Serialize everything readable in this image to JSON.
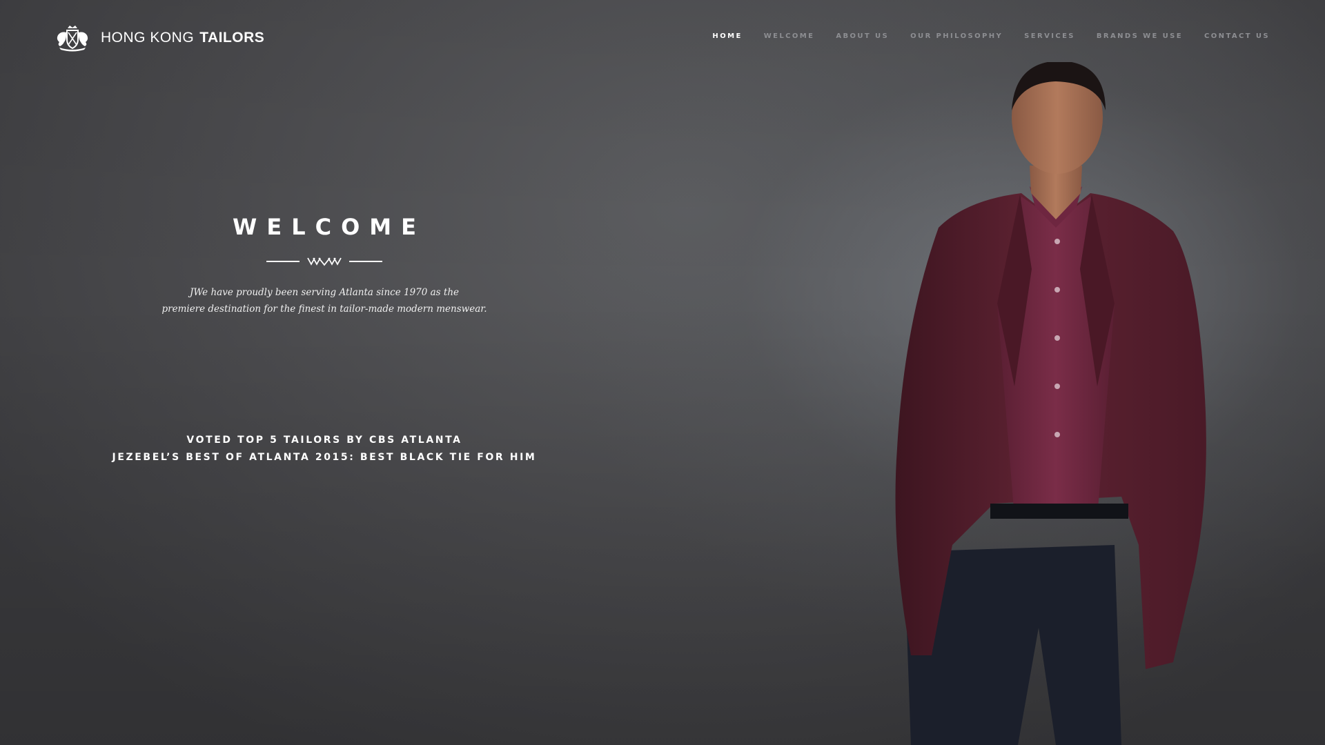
{
  "brand": {
    "name_light": "HONG KONG",
    "name_bold": "TAILORS",
    "crest_icon": "crest-logo-icon"
  },
  "nav": {
    "items": [
      {
        "label": "HOME",
        "active": true
      },
      {
        "label": "WELCOME",
        "active": false
      },
      {
        "label": "ABOUT US",
        "active": false
      },
      {
        "label": "OUR PHILOSOPHY",
        "active": false
      },
      {
        "label": "SERVICES",
        "active": false
      },
      {
        "label": "BRANDS WE USE",
        "active": false
      },
      {
        "label": "CONTACT US",
        "active": false
      }
    ]
  },
  "welcome": {
    "title": "WELCOME",
    "line1": "JWe have proudly been serving Atlanta since 1970 as the",
    "line2": "premiere destination for the finest in tailor-made modern menswear."
  },
  "awards": {
    "line1": "VOTED TOP 5 TAILORS BY CBS ATLANTA",
    "line2": "JEZEBEL’S BEST OF ATLANTA 2015: BEST BLACK TIE FOR HIM"
  },
  "colors": {
    "background": "#4a4a4c",
    "nav_inactive": "#8d8e92",
    "nav_active": "#ffffff",
    "jacket": "#5e2232",
    "shirt": "#6e2640",
    "trousers": "#1b1f2b"
  }
}
